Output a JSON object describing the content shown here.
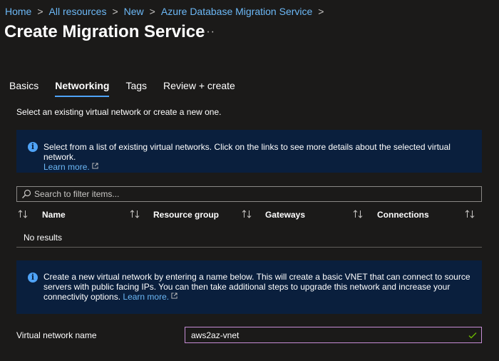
{
  "breadcrumb": {
    "items": [
      "Home",
      "All resources",
      "New",
      "Azure Database Migration Service"
    ],
    "separator": ">"
  },
  "page": {
    "title": "Create Migration Service",
    "more_label": "···"
  },
  "tabs": [
    {
      "label": "Basics",
      "active": false
    },
    {
      "label": "Networking",
      "active": true
    },
    {
      "label": "Tags",
      "active": false
    },
    {
      "label": "Review + create",
      "active": false
    }
  ],
  "intro_text": "Select an existing virtual network or create a new one.",
  "info_existing": {
    "text": "Select from a list of existing virtual networks. Click on the links to see more details about the selected virtual network.",
    "link": "Learn more."
  },
  "search": {
    "placeholder": "Search to filter items...",
    "value": ""
  },
  "table": {
    "columns": [
      "Name",
      "Resource group",
      "Gateways",
      "Connections"
    ],
    "empty_text": "No results"
  },
  "info_create": {
    "text": "Create a new virtual network by entering a name below. This will create a basic VNET that can connect to source servers with public facing IPs. You can then take additional steps to upgrade this network and increase your connectivity options.",
    "link": "Learn more."
  },
  "vnet": {
    "label": "Virtual network name",
    "value": "aws2az-vnet"
  },
  "colors": {
    "background": "#1b1a19",
    "link": "#6cb8f6",
    "info_background": "#0a1f3d",
    "valid_check": "#6bb700",
    "field_border_focus": "#c78dd6"
  }
}
